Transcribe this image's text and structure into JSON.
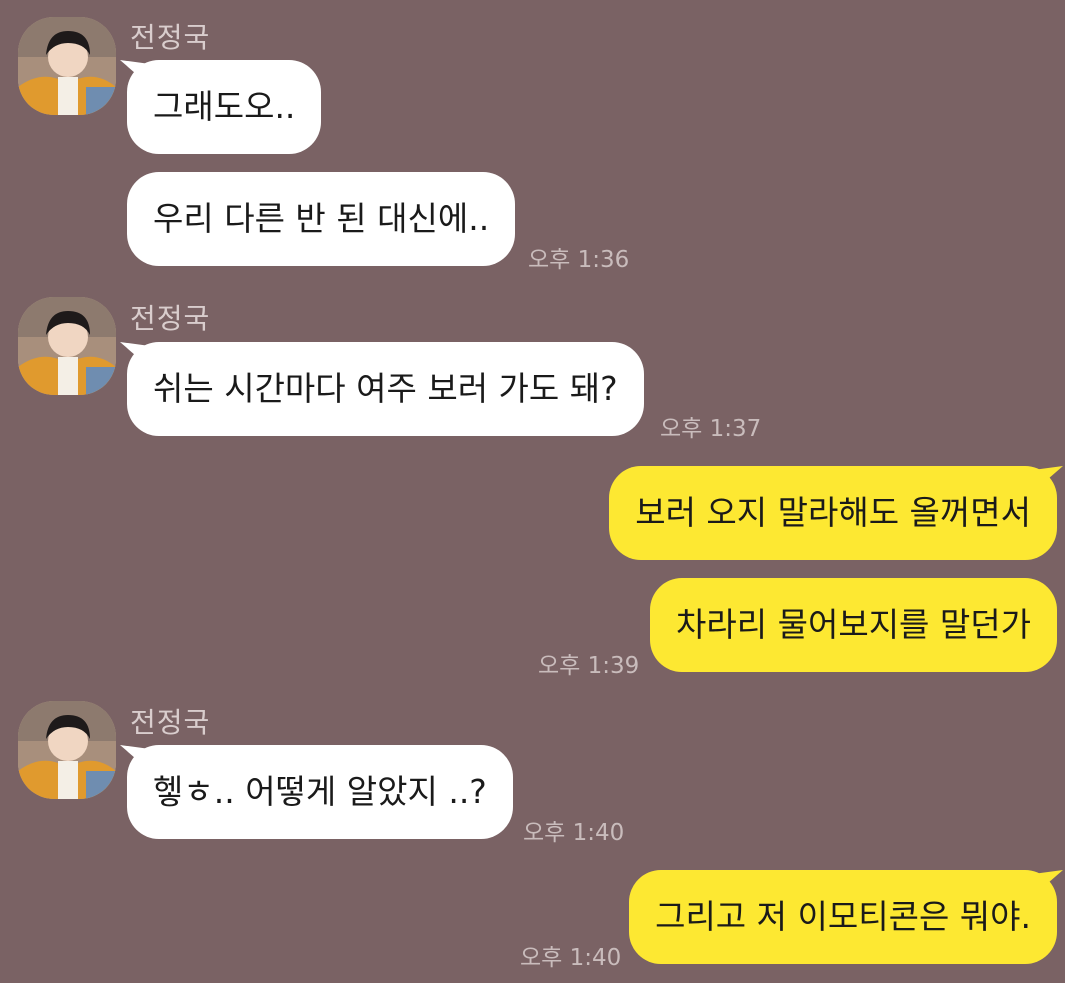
{
  "chat": {
    "groups": [
      {
        "sender": "전정국",
        "messages": [
          "그래도오..",
          "우리 다른 반 된 대신에.."
        ],
        "time": "오후 1:36"
      },
      {
        "sender": "전정국",
        "messages": [
          "쉬는 시간마다 여주 보러 가도 돼?"
        ],
        "time": "오후 1:37"
      },
      {
        "sender": "me",
        "messages": [
          "보러 오지 말라해도 올꺼면서",
          "차라리 물어보지를 말던가"
        ],
        "time": "오후 1:39"
      },
      {
        "sender": "전정국",
        "messages": [
          "헿ㅎ.. 어떻게 알았지 ..?"
        ],
        "time": "오후 1:40"
      },
      {
        "sender": "me",
        "messages": [
          "그리고 저 이모티콘은 뭐야."
        ],
        "time": "오후 1:40"
      }
    ]
  },
  "colors": {
    "background": "#7a6264",
    "incoming_bubble": "#ffffff",
    "outgoing_bubble": "#fde832"
  },
  "icons": {
    "avatar": "profile-photo"
  }
}
